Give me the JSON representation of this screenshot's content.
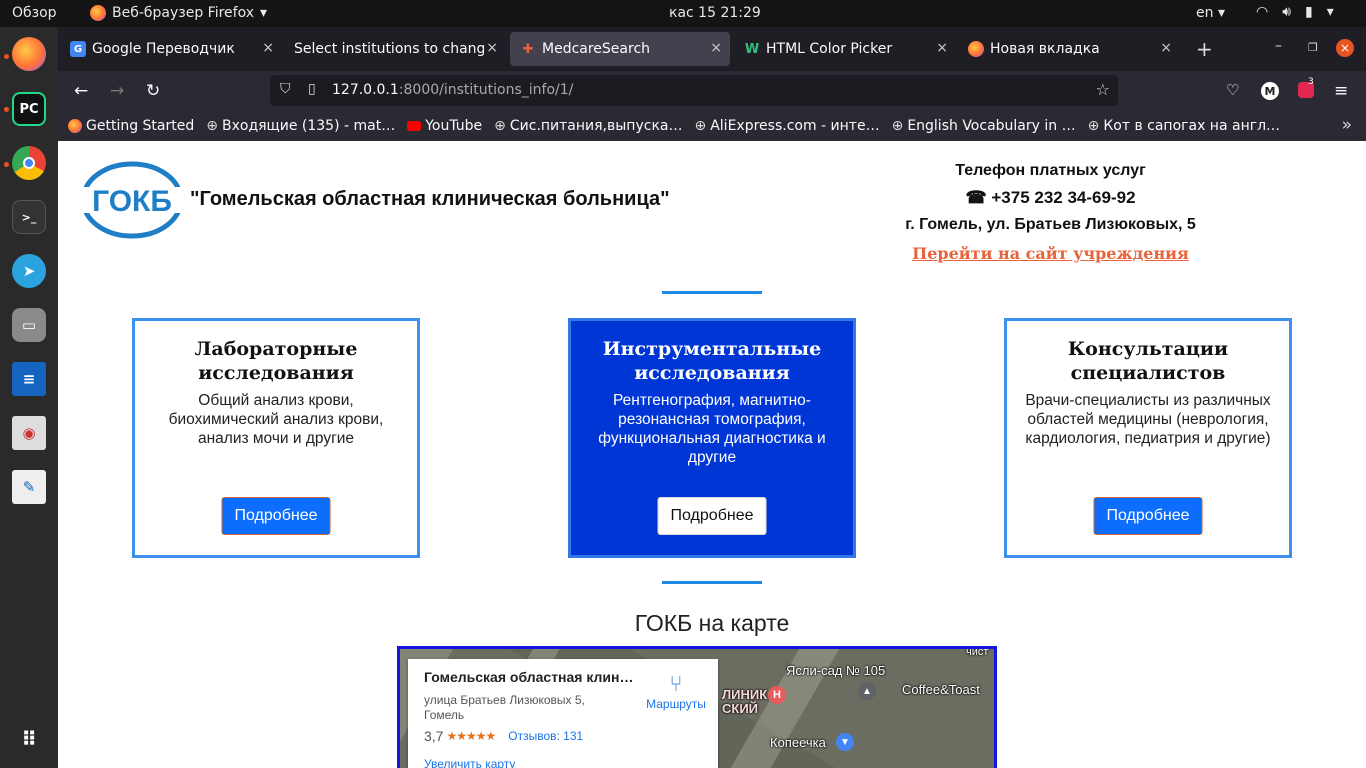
{
  "topbar": {
    "overview": "Обзор",
    "app_name": "Веб-браузер Firefox",
    "clock": "кас 15  21:29",
    "lang": "en"
  },
  "tabs": [
    {
      "title": "Google Переводчик",
      "close": "×"
    },
    {
      "title": "Select institutions to change",
      "close": "×"
    },
    {
      "title": "MedcareSearch",
      "close": "×"
    },
    {
      "title": "HTML Color Picker",
      "close": "×"
    },
    {
      "title": "Новая вкладка",
      "close": "×"
    }
  ],
  "address": {
    "host": "127.0.0.1",
    "path": ":8000/institutions_info/1/"
  },
  "ext_badge": "3",
  "bookmarks": [
    "Getting Started",
    "Входящие (135) - mat…",
    "YouTube",
    "Сис.питания,выпуска…",
    "AliExpress.com - инте…",
    "English Vocabulary in …",
    "Кот в сапогах на англ…"
  ],
  "page": {
    "logo_text": "ГОКБ",
    "institution_name": "\"Гомельская областная клиническая больница\"",
    "contact": {
      "heading": "Телефон платных услуг",
      "phone": "+375 232 34-69-92",
      "address": "г. Гомель, ул. Братьев Лизюковых, 5",
      "site_link": "Перейти на сайт учреждения"
    },
    "cards": [
      {
        "title": "Лабораторные исследования",
        "text": "Общий анализ крови, биохимический анализ крови, анализ мочи и другие",
        "button": "Подробнее"
      },
      {
        "title": "Инструментальные исследования",
        "text": "Рентгенография, магнитно-резонансная томография, функциональная диагностика и другие",
        "button": "Подробнее"
      },
      {
        "title": "Консультации специалистов",
        "text": "Врачи-специалисты из различных областей медицины (неврология, кардиология, педиатрия и другие)",
        "button": "Подробнее"
      }
    ],
    "map_title": "ГОКБ на карте",
    "map": {
      "place_name": "Гомельская областная клин…",
      "address": "улица Братьев Лизюковых 5, Гомель",
      "rating": "3,7",
      "stars": "★★★★★",
      "reviews": "Отзывов: 131",
      "zoom": "Увеличить карту",
      "route": "Маршруты",
      "labels": [
        "Ясли-сад № 105",
        "Coffee&Toast",
        "Копеечка",
        "ЛИНИК",
        "СКИЙ",
        "чист"
      ]
    }
  }
}
